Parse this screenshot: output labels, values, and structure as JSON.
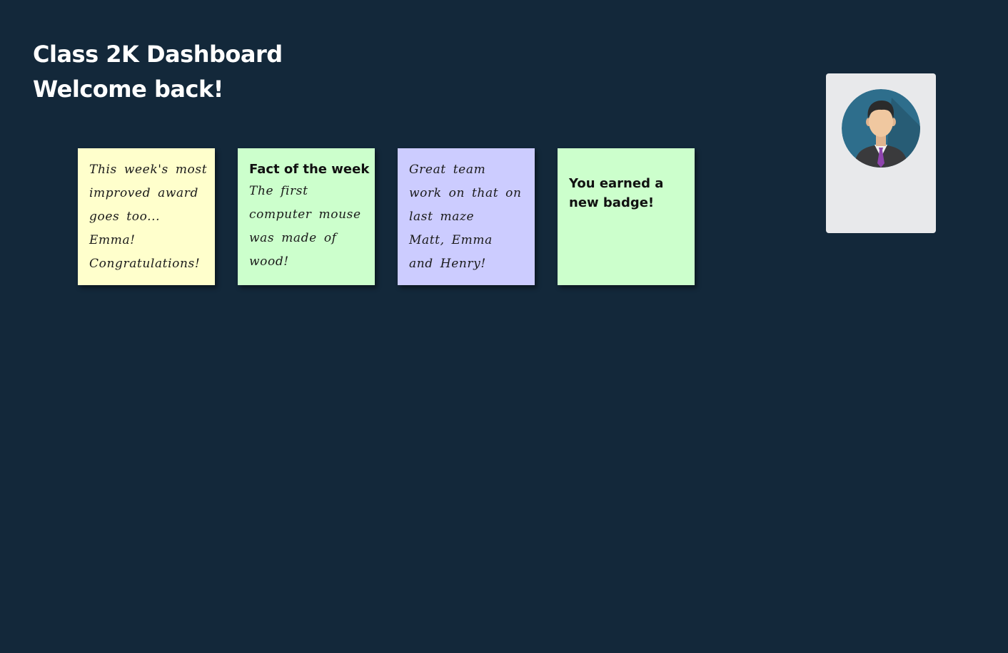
{
  "header": {
    "title": "Class 2K Dashboard",
    "subtitle": "Welcome back!"
  },
  "notes": [
    {
      "color": "#ffffcc",
      "lines": [
        "This week's most",
        "improved award",
        "goes too...",
        "Emma!",
        "Congratulations!"
      ]
    },
    {
      "color": "#ccffcc",
      "heading": "Fact of the week",
      "lines": [
        "The first",
        "computer mouse",
        "was made of",
        "wood!"
      ]
    },
    {
      "color": "#ccccff",
      "lines": [
        "Great team",
        "work on that on",
        "last maze",
        "Matt, Emma",
        "and Henry!"
      ]
    },
    {
      "color": "#ccffcc",
      "lines": [
        "You earned a",
        "new badge!"
      ]
    }
  ],
  "profile": {
    "avatar_icon": "user-avatar-icon",
    "card_color": "#e8e9eb",
    "avatar_bg": "#2e6e8c"
  },
  "theme": {
    "background": "#13283a"
  }
}
